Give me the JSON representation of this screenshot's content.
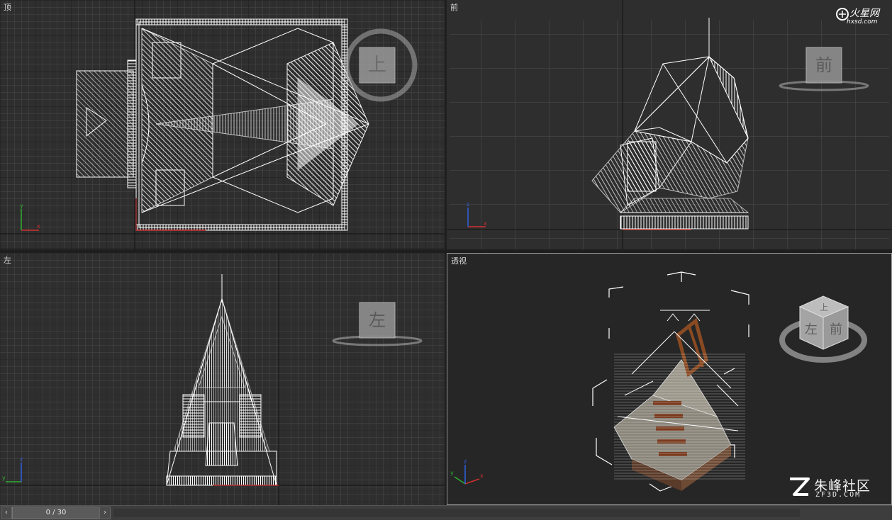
{
  "viewports": {
    "top": {
      "label": "顶",
      "cube_face": "上"
    },
    "front": {
      "label": "前",
      "cube_face": "前"
    },
    "left": {
      "label": "左",
      "cube_face": "左"
    },
    "persp": {
      "label": "透视",
      "cube_faces": [
        "左",
        "前",
        "上"
      ]
    }
  },
  "timeline": {
    "frame": "0 / 30",
    "prev_icon": "chevron-left-icon",
    "next_icon": "chevron-right-icon"
  },
  "watermarks": {
    "top_right": {
      "cn": "火星网",
      "en": "hxsd.com"
    },
    "bottom_right": {
      "cn": "朱峰社区",
      "en": "ZF3D.COM"
    }
  },
  "axis_labels": {
    "x": "x",
    "y": "y",
    "z": "z"
  },
  "colors": {
    "grid_bg": "#2e2e2e",
    "grid_line": "#4a4a4a",
    "grid_major": "#1a1a1a",
    "wire": "#ffffff",
    "roof": "#8a857a",
    "wood": "#7a3b1e",
    "axis_x": "#d03030",
    "axis_y": "#30b030",
    "axis_z": "#3060e0"
  }
}
